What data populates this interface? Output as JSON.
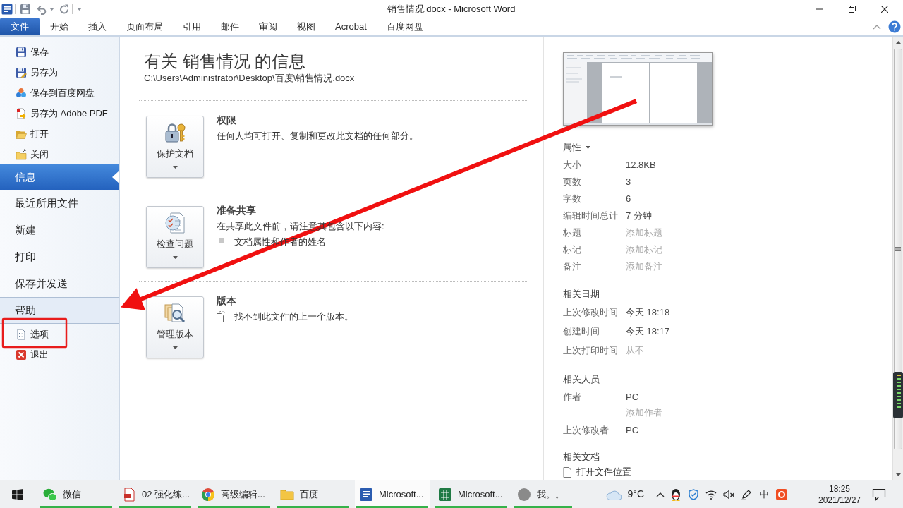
{
  "window": {
    "title": "销售情况.docx - Microsoft Word"
  },
  "ribbon_tabs": [
    {
      "label": "文件",
      "selected": true
    },
    {
      "label": "开始",
      "selected": false
    },
    {
      "label": "插入",
      "selected": false
    },
    {
      "label": "页面布局",
      "selected": false
    },
    {
      "label": "引用",
      "selected": false
    },
    {
      "label": "邮件",
      "selected": false
    },
    {
      "label": "审阅",
      "selected": false
    },
    {
      "label": "视图",
      "selected": false
    },
    {
      "label": "Acrobat",
      "selected": false
    },
    {
      "label": "百度网盘",
      "selected": false
    }
  ],
  "file_commands": [
    "保存",
    "另存为",
    "保存到百度网盘",
    "另存为 Adobe PDF",
    "打开",
    "关闭"
  ],
  "pages": [
    {
      "label": "信息",
      "selected": true,
      "hovered": false
    },
    {
      "label": "最近所用文件",
      "selected": false,
      "hovered": false
    },
    {
      "label": "新建",
      "selected": false,
      "hovered": false
    },
    {
      "label": "打印",
      "selected": false,
      "hovered": false
    },
    {
      "label": "保存并发送",
      "selected": false,
      "hovered": false
    },
    {
      "label": "帮助",
      "selected": false,
      "hovered": true
    }
  ],
  "app_commands": [
    "选项",
    "退出"
  ],
  "info": {
    "heading": "有关 销售情况 的信息",
    "path": "C:\\Users\\Administrator\\Desktop\\百度\\销售情况.docx",
    "sections": [
      {
        "button": "保护文档",
        "title": "权限",
        "description": "任何人均可打开、复制和更改此文档的任何部分。"
      },
      {
        "button": "检查问题",
        "title": "准备共享",
        "description": "在共享此文件前，请注意其包含以下内容:",
        "bullets": [
          "文档属性和作者的姓名"
        ]
      },
      {
        "button": "管理版本",
        "title": "版本",
        "note": "找不到此文件的上一个版本。"
      }
    ]
  },
  "properties": {
    "header": "属性",
    "rows": [
      {
        "label": "大小",
        "value": "12.8KB"
      },
      {
        "label": "页数",
        "value": "3"
      },
      {
        "label": "字数",
        "value": "6"
      },
      {
        "label": "编辑时间总计",
        "value": "7 分钟"
      },
      {
        "label": "标题",
        "placeholder": "添加标题"
      },
      {
        "label": "标记",
        "placeholder": "添加标记"
      },
      {
        "label": "备注",
        "placeholder": "添加备注"
      }
    ]
  },
  "related_dates": {
    "header": "相关日期",
    "rows": [
      {
        "label": "上次修改时间",
        "value": "今天 18:18",
        "muted": false
      },
      {
        "label": "创建时间",
        "value": "今天 18:17",
        "muted": false
      },
      {
        "label": "上次打印时间",
        "value": "从不",
        "muted": true
      }
    ]
  },
  "related_people": {
    "header": "相关人员",
    "rows": [
      {
        "label": "作者",
        "value": "PC",
        "add_placeholder": "添加作者"
      },
      {
        "label": "上次修改者",
        "value": "PC"
      }
    ]
  },
  "related_documents": {
    "header": "相关文档",
    "links": [
      "打开文件位置"
    ]
  },
  "taskbar": {
    "apps": [
      {
        "label": "微信",
        "selected": false
      },
      {
        "label": "02 强化练...",
        "selected": false
      },
      {
        "label": "高级编辑...",
        "selected": false
      },
      {
        "label": "百度",
        "selected": false
      },
      {
        "label": "Microsoft...",
        "selected": true
      },
      {
        "label": "Microsoft...",
        "selected": false
      },
      {
        "label": "我。。",
        "selected": false
      }
    ],
    "weather": "9°C",
    "input_method": "中",
    "time": "18:25",
    "date": "2021/12/27"
  }
}
